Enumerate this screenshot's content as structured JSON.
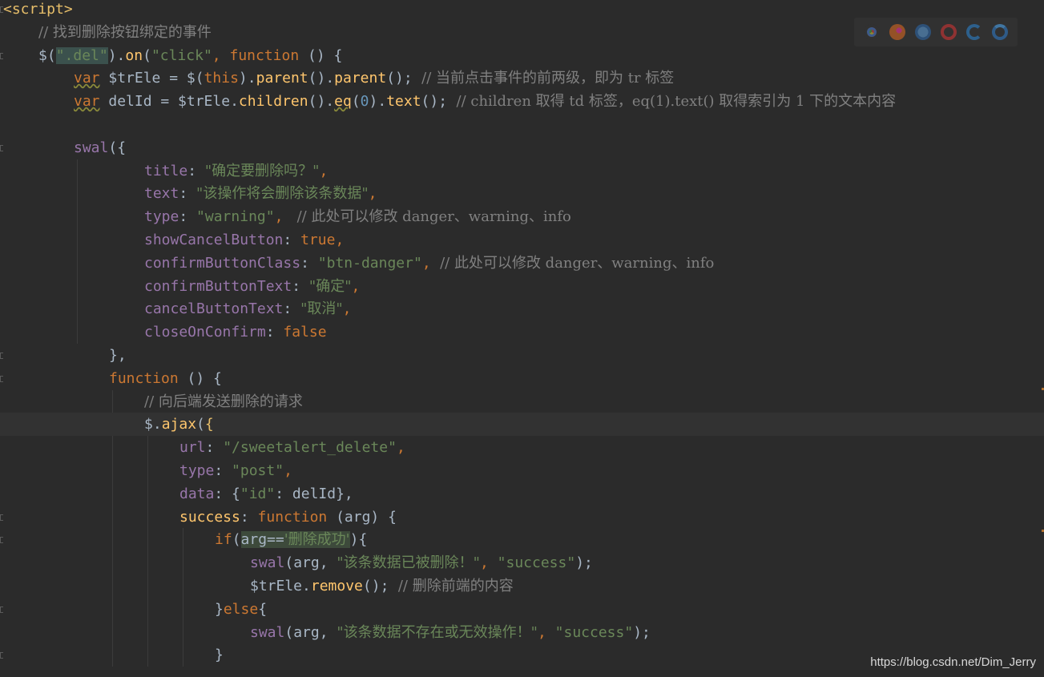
{
  "lines": [
    [
      {
        "t": "<script>",
        "c": "tag"
      }
    ],
    [
      {
        "t": "// 找到删除按钮绑定的事件",
        "c": "cmt"
      }
    ],
    [
      {
        "t": "$(",
        "c": "plain"
      },
      {
        "t": "\".del\"",
        "c": "str"
      },
      {
        "t": ").",
        "c": "plain"
      },
      {
        "t": "on",
        "c": "fn"
      },
      {
        "t": "(",
        "c": "plain"
      },
      {
        "t": "\"click\"",
        "c": "str"
      },
      {
        "t": ", ",
        "c": "punc"
      },
      {
        "t": "function",
        "c": "kw"
      },
      {
        "t": " () {",
        "c": "plain"
      }
    ],
    [
      {
        "t": "var",
        "c": "kw"
      },
      {
        "t": " $trEle = $(",
        "c": "plain"
      },
      {
        "t": "this",
        "c": "kw"
      },
      {
        "t": ").",
        "c": "plain"
      },
      {
        "t": "parent",
        "c": "fn"
      },
      {
        "t": "().",
        "c": "plain"
      },
      {
        "t": "parent",
        "c": "fn"
      },
      {
        "t": "();",
        "c": "plain"
      },
      {
        "t": "  // 当前点击事件的前两级，即为 tr 标签",
        "c": "cmt"
      }
    ],
    [
      {
        "t": "var",
        "c": "kw"
      },
      {
        "t": " delId = $trEle.",
        "c": "plain"
      },
      {
        "t": "children",
        "c": "fn"
      },
      {
        "t": "().",
        "c": "plain"
      },
      {
        "t": "eq",
        "c": "fn"
      },
      {
        "t": "(",
        "c": "plain"
      },
      {
        "t": "0",
        "c": "num"
      },
      {
        "t": ").",
        "c": "plain"
      },
      {
        "t": "text",
        "c": "fn"
      },
      {
        "t": "();",
        "c": "plain"
      },
      {
        "t": "  // children 取得 td 标签，eq(1).text() 取得索引为 1 下的文本内容",
        "c": "cmt"
      }
    ],
    [],
    [
      {
        "t": "swal",
        "c": "prop"
      },
      {
        "t": "({",
        "c": "plain"
      }
    ],
    [
      {
        "t": "title",
        "c": "prop"
      },
      {
        "t": ": ",
        "c": "plain"
      },
      {
        "t": "\"确定要删除吗？\"",
        "c": "str"
      },
      {
        "t": ",",
        "c": "punc"
      }
    ],
    [
      {
        "t": "text",
        "c": "prop"
      },
      {
        "t": ": ",
        "c": "plain"
      },
      {
        "t": "\"该操作将会删除该条数据\"",
        "c": "str"
      },
      {
        "t": ",",
        "c": "punc"
      }
    ],
    [
      {
        "t": "type",
        "c": "prop"
      },
      {
        "t": ": ",
        "c": "plain"
      },
      {
        "t": "\"warning\"",
        "c": "str"
      },
      {
        "t": ",",
        "c": "punc"
      },
      {
        "t": "   // 此处可以修改 danger、warning、info",
        "c": "cmt"
      }
    ],
    [
      {
        "t": "showCancelButton",
        "c": "prop"
      },
      {
        "t": ": ",
        "c": "plain"
      },
      {
        "t": "true",
        "c": "kw"
      },
      {
        "t": ",",
        "c": "punc"
      }
    ],
    [
      {
        "t": "confirmButtonClass",
        "c": "prop"
      },
      {
        "t": ": ",
        "c": "plain"
      },
      {
        "t": "\"btn-danger\"",
        "c": "str"
      },
      {
        "t": ",",
        "c": "punc"
      },
      {
        "t": "  // 此处可以修改 danger、warning、info",
        "c": "cmt"
      }
    ],
    [
      {
        "t": "confirmButtonText",
        "c": "prop"
      },
      {
        "t": ": ",
        "c": "plain"
      },
      {
        "t": "\"确定\"",
        "c": "str"
      },
      {
        "t": ",",
        "c": "punc"
      }
    ],
    [
      {
        "t": "cancelButtonText",
        "c": "prop"
      },
      {
        "t": ": ",
        "c": "plain"
      },
      {
        "t": "\"取消\"",
        "c": "str"
      },
      {
        "t": ",",
        "c": "punc"
      }
    ],
    [
      {
        "t": "closeOnConfirm",
        "c": "prop"
      },
      {
        "t": ": ",
        "c": "plain"
      },
      {
        "t": "false",
        "c": "kw"
      }
    ],
    [
      {
        "t": "},",
        "c": "plain"
      }
    ],
    [
      {
        "t": "function",
        "c": "kw"
      },
      {
        "t": " () {",
        "c": "plain"
      }
    ],
    [
      {
        "t": "// 向后端发送删除的请求",
        "c": "cmt"
      }
    ],
    [
      {
        "t": "$.",
        "c": "plain"
      },
      {
        "t": "ajax",
        "c": "fn"
      },
      {
        "t": "(",
        "c": "plain"
      },
      {
        "t": "{",
        "c": "tag"
      }
    ],
    [
      {
        "t": "url",
        "c": "prop"
      },
      {
        "t": ": ",
        "c": "plain"
      },
      {
        "t": "\"/sweetalert_delete\"",
        "c": "str"
      },
      {
        "t": ",",
        "c": "punc"
      }
    ],
    [
      {
        "t": "type",
        "c": "prop"
      },
      {
        "t": ": ",
        "c": "plain"
      },
      {
        "t": "\"post\"",
        "c": "str"
      },
      {
        "t": ",",
        "c": "punc"
      }
    ],
    [
      {
        "t": "data",
        "c": "prop"
      },
      {
        "t": ": {",
        "c": "plain"
      },
      {
        "t": "\"id\"",
        "c": "str"
      },
      {
        "t": ": delId},",
        "c": "plain"
      }
    ],
    [
      {
        "t": "success",
        "c": "fn"
      },
      {
        "t": ": ",
        "c": "plain"
      },
      {
        "t": "function",
        "c": "kw"
      },
      {
        "t": " (arg) {",
        "c": "plain"
      }
    ],
    [
      {
        "t": "if",
        "c": "kw"
      },
      {
        "t": "(",
        "c": "plain"
      },
      {
        "t": "arg==",
        "c": "plain"
      },
      {
        "t": "'删除成功'",
        "c": "str"
      },
      {
        "t": "){",
        "c": "plain"
      }
    ],
    [
      {
        "t": "swal",
        "c": "prop"
      },
      {
        "t": "(arg, ",
        "c": "plain"
      },
      {
        "t": "\"该条数据已被删除！\"",
        "c": "str"
      },
      {
        "t": ", ",
        "c": "punc"
      },
      {
        "t": "\"success\"",
        "c": "str"
      },
      {
        "t": ");",
        "c": "plain"
      }
    ],
    [
      {
        "t": "$trEle.",
        "c": "plain"
      },
      {
        "t": "remove",
        "c": "fn"
      },
      {
        "t": "();",
        "c": "plain"
      },
      {
        "t": "  // 删除前端的内容",
        "c": "cmt"
      }
    ],
    [
      {
        "t": "}",
        "c": "plain"
      },
      {
        "t": "else",
        "c": "kw"
      },
      {
        "t": "{",
        "c": "plain"
      }
    ],
    [
      {
        "t": "swal",
        "c": "prop"
      },
      {
        "t": "(arg, ",
        "c": "plain"
      },
      {
        "t": "\"该条数据不存在或无效操作！\"",
        "c": "str"
      },
      {
        "t": ", ",
        "c": "punc"
      },
      {
        "t": "\"success\"",
        "c": "str"
      },
      {
        "t": ");",
        "c": "plain"
      }
    ],
    [
      {
        "t": "}",
        "c": "plain"
      }
    ]
  ],
  "browser_icons": [
    "chrome-icon",
    "firefox-icon",
    "safari-icon",
    "opera-icon",
    "ie-icon",
    "edge-icon"
  ],
  "watermark": "https://blog.csdn.net/Dim_Jerry",
  "colors": {
    "background": "#2b2b2b",
    "keyword": "#cc7832",
    "string": "#6a8759",
    "comment": "#808080",
    "property": "#9876aa",
    "function": "#ffc66d",
    "number": "#6897bb",
    "text": "#a9b7c6"
  }
}
